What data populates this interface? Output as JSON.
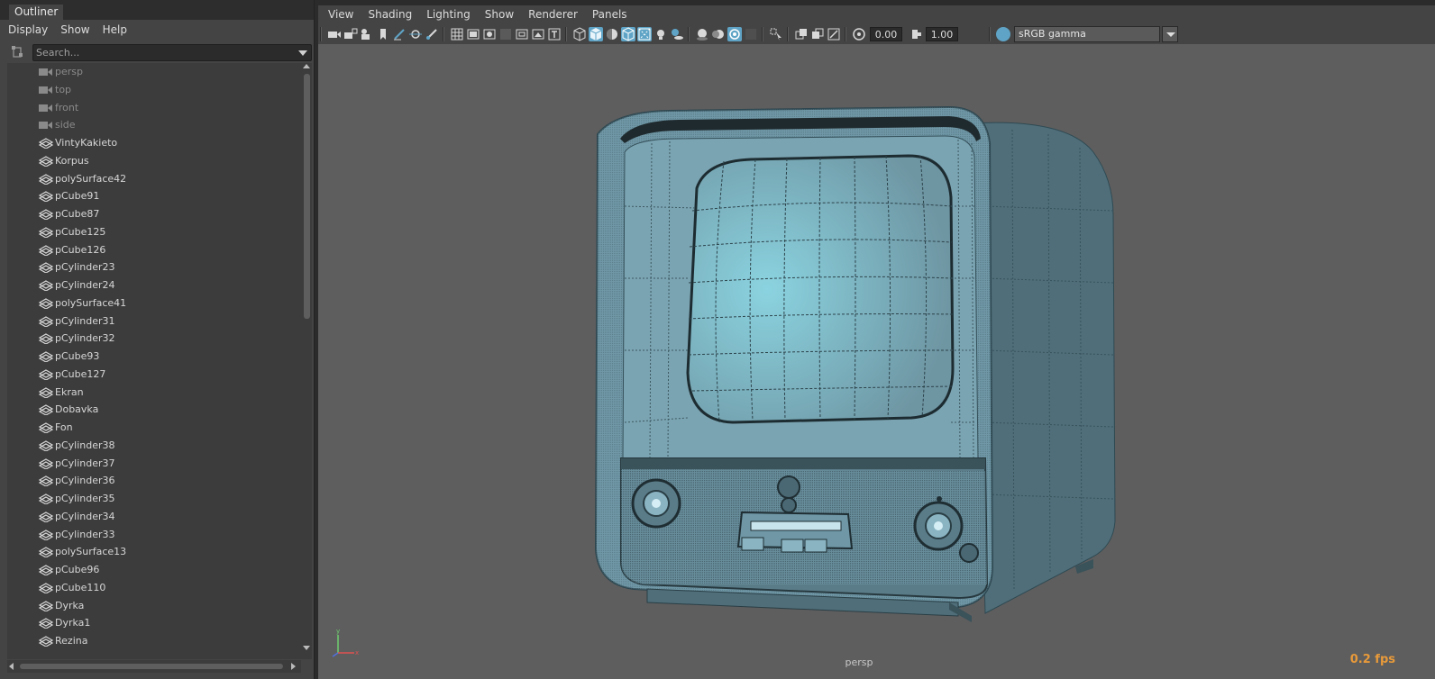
{
  "outliner": {
    "tab_label": "Outliner",
    "menu": [
      "Display",
      "Show",
      "Help"
    ],
    "search": {
      "placeholder": "Search...",
      "value": ""
    },
    "items": [
      {
        "label": "persp",
        "type": "camera"
      },
      {
        "label": "top",
        "type": "camera"
      },
      {
        "label": "front",
        "type": "camera"
      },
      {
        "label": "side",
        "type": "camera"
      },
      {
        "label": "VintyKakieto",
        "type": "mesh"
      },
      {
        "label": "Korpus",
        "type": "mesh"
      },
      {
        "label": "polySurface42",
        "type": "mesh"
      },
      {
        "label": "pCube91",
        "type": "mesh"
      },
      {
        "label": "pCube87",
        "type": "mesh"
      },
      {
        "label": "pCube125",
        "type": "mesh"
      },
      {
        "label": "pCube126",
        "type": "mesh"
      },
      {
        "label": "pCylinder23",
        "type": "mesh"
      },
      {
        "label": "pCylinder24",
        "type": "mesh"
      },
      {
        "label": "polySurface41",
        "type": "mesh"
      },
      {
        "label": "pCylinder31",
        "type": "mesh"
      },
      {
        "label": "pCylinder32",
        "type": "mesh"
      },
      {
        "label": "pCube93",
        "type": "mesh"
      },
      {
        "label": "pCube127",
        "type": "mesh"
      },
      {
        "label": "Ekran",
        "type": "mesh"
      },
      {
        "label": "Dobavka",
        "type": "mesh"
      },
      {
        "label": "Fon",
        "type": "mesh"
      },
      {
        "label": "pCylinder38",
        "type": "mesh"
      },
      {
        "label": "pCylinder37",
        "type": "mesh"
      },
      {
        "label": "pCylinder36",
        "type": "mesh"
      },
      {
        "label": "pCylinder35",
        "type": "mesh"
      },
      {
        "label": "pCylinder34",
        "type": "mesh"
      },
      {
        "label": "pCylinder33",
        "type": "mesh"
      },
      {
        "label": "polySurface13",
        "type": "mesh"
      },
      {
        "label": "pCube96",
        "type": "mesh"
      },
      {
        "label": "pCube110",
        "type": "mesh"
      },
      {
        "label": "Dyrka",
        "type": "mesh"
      },
      {
        "label": "Dyrka1",
        "type": "mesh"
      },
      {
        "label": "Rezina",
        "type": "mesh"
      }
    ]
  },
  "viewport": {
    "menu": [
      "View",
      "Shading",
      "Lighting",
      "Show",
      "Renderer",
      "Panels"
    ],
    "exposure": "0.00",
    "gamma": "1.00",
    "color_space": "sRGB gamma",
    "camera": "persp",
    "fps": "0.2 fps",
    "axis": {
      "x": "x",
      "y": "y"
    }
  },
  "colors": {
    "accent": "#5fa4c6",
    "fps": "#e89a3a",
    "viewport_bg": "#5e5e5e",
    "model": "#6f97a6"
  },
  "toolbar_icons": [
    "camera-icon",
    "camera-lock-icon",
    "camera-attributes-icon",
    "bookmark-icon",
    "grease-pencil-icon",
    "image-plane-icon",
    "camera-2d-pan-icon",
    "grid-icon",
    "film-gate-icon",
    "resolution-gate-icon",
    "gate-mask-icon",
    "field-chart-icon",
    "safe-action-icon",
    "safe-title-icon",
    "wireframe-icon",
    "smooth-shade-icon",
    "default-material-icon",
    "wireframe-on-shaded-icon",
    "xray-icon",
    "textured-icon",
    "lights-icon",
    "shadows-icon",
    "ambient-occlusion-icon",
    "motion-blur-icon",
    "antialiasing-icon",
    "depth-of-field-icon",
    "isolate-select-icon",
    "xray-joints-icon",
    "xray-active-icon",
    "backface-icon",
    "exposure-icon",
    "gamma-icon",
    "color-management-icon"
  ]
}
